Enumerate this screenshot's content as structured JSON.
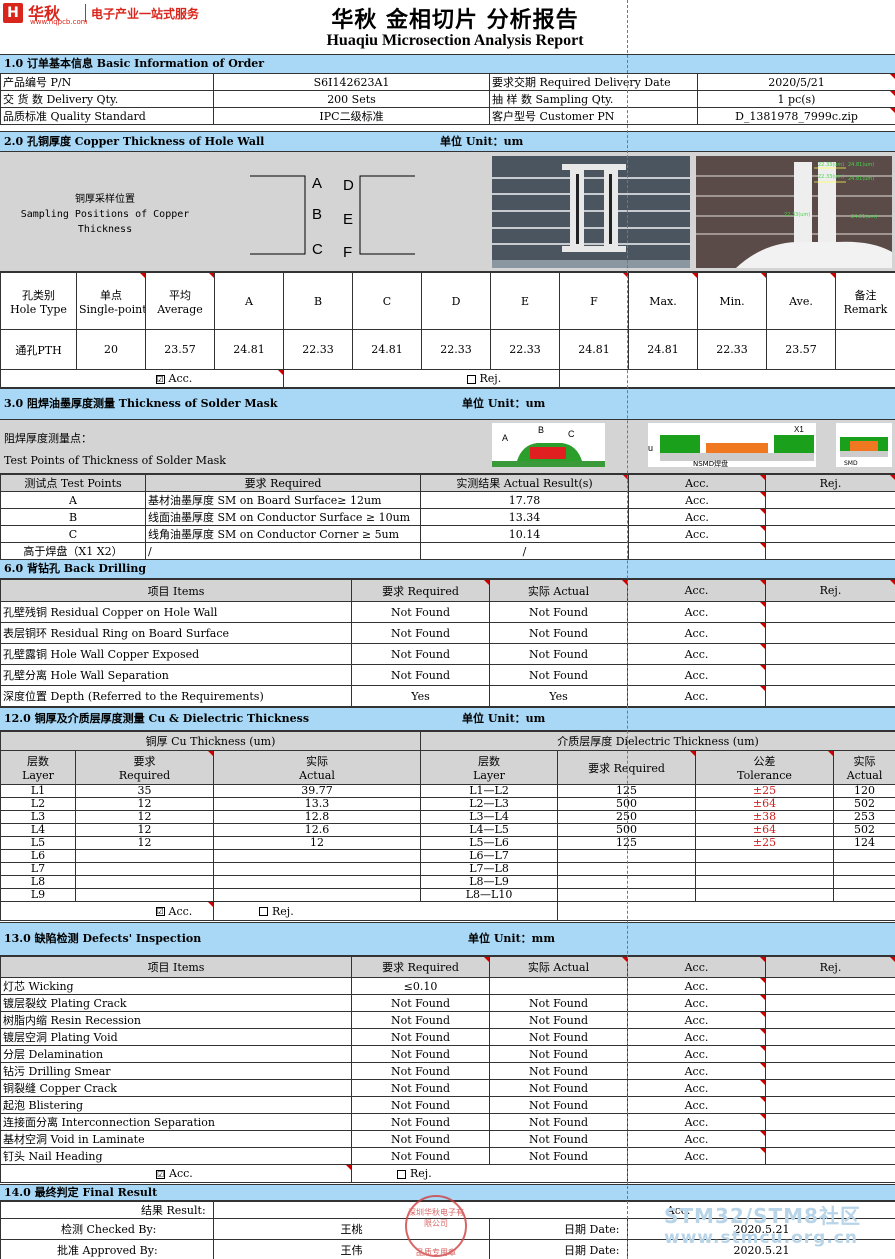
{
  "header": {
    "logo_glyph": "H",
    "logo_cn": "华秋",
    "logo_url": "www.hqpcb.com",
    "slogan": "电子产业一站式服务",
    "title_cn": "华秋 金相切片 分析报告",
    "title_en": "Huaqiu Microsection Analysis Report"
  },
  "s1": {
    "title": "1.0 订单基本信息 Basic Information of Order",
    "rows": [
      [
        "产品编号 P/N",
        "S6I142623A1",
        "要求交期 Required Delivery Date",
        "2020/5/21"
      ],
      [
        "交 货 数 Delivery Qty.",
        "200 Sets",
        "抽 样 数 Sampling Qty.",
        "1 pc(s)"
      ],
      [
        "品质标准 Quality Standard",
        "IPC二级标准",
        "客户型号 Customer PN",
        "D_1381978_7999c.zip"
      ]
    ]
  },
  "s2": {
    "title": "2.0 孔铜厚度 Copper Thickness of Hole Wall",
    "unit": "单位 Unit：um",
    "pos_cn": "铜厚采样位置",
    "pos_en1": "Sampling Positions of Copper",
    "pos_en2": "Thickness",
    "letters": [
      "A",
      "B",
      "C",
      "D",
      "E",
      "F"
    ],
    "img1_labels": [
      "22.33",
      "24.81",
      "23.57"
    ],
    "img2_labels": [
      "22.33(um)",
      "24.81(um)",
      "22.33(um)",
      "24.81(um)",
      "22.33(um)",
      "24.81(um)"
    ],
    "headers": [
      [
        "孔类别",
        "Hole Type"
      ],
      [
        "单点",
        "Single-point"
      ],
      [
        "平均",
        "Average"
      ],
      [
        "A"
      ],
      [
        "B"
      ],
      [
        "C"
      ],
      [
        "D"
      ],
      [
        "E"
      ],
      [
        "F"
      ],
      [
        "Max."
      ],
      [
        "Min."
      ],
      [
        "Ave."
      ],
      [
        "备注",
        "Remark"
      ]
    ],
    "values": [
      "通孔PTH",
      "20",
      "23.57",
      "24.81",
      "22.33",
      "24.81",
      "22.33",
      "22.33",
      "24.81",
      "24.81",
      "22.33",
      "23.57",
      ""
    ],
    "acc": "Acc.",
    "rej": "Rej.",
    "acc_mark": "☑"
  },
  "s3": {
    "title": "3.0 阻焊油墨厚度测量 Thickness of Solder Mask",
    "unit": "单位 Unit：um",
    "tp_cn": "阻焊厚度测量点：",
    "tp_en": "Test Points of Thickness of Solder Mask",
    "diag_labels": [
      "A",
      "B",
      "C"
    ],
    "diag2_labels": [
      "X1",
      "u",
      "NSMD焊盘"
    ],
    "diag3_label": "SMD",
    "headers": [
      "测试点 Test Points",
      "要求 Required",
      "实测结果 Actual Result(s)",
      "Acc.",
      "Rej."
    ],
    "rows": [
      [
        "A",
        "基材油墨厚度 SM on Board Surface≥ 12um",
        "17.78",
        "Acc.",
        ""
      ],
      [
        "B",
        "线面油墨厚度 SM on Conductor Surface ≥ 10um",
        "13.34",
        "Acc.",
        ""
      ],
      [
        "C",
        "线角油墨厚度 SM on Conductor Corner ≥ 5um",
        "10.14",
        "Acc.",
        ""
      ],
      [
        "高于焊盘（X1 X2）",
        "/",
        "/",
        "",
        ""
      ]
    ]
  },
  "s6": {
    "title": "6.0 背钻孔 Back Drilling",
    "headers": [
      "项目 Items",
      "要求 Required",
      "实际 Actual",
      "Acc.",
      "Rej."
    ],
    "rows": [
      [
        "孔壁残铜 Residual Copper on Hole Wall",
        "Not Found",
        "Not Found",
        "Acc.",
        ""
      ],
      [
        "表层铜环 Residual Ring on Board Surface",
        "Not Found",
        "Not Found",
        "Acc.",
        ""
      ],
      [
        "孔壁露铜 Hole Wall Copper Exposed",
        "Not Found",
        "Not Found",
        "Acc.",
        ""
      ],
      [
        "孔壁分离 Hole Wall Separation",
        "Not Found",
        "Not Found",
        "Acc.",
        ""
      ],
      [
        "深度位置 Depth (Referred to the Requirements)",
        "Yes",
        "Yes",
        "Acc.",
        ""
      ]
    ]
  },
  "s12": {
    "title": "12.0 铜厚及介质层厚度测量 Cu & Dielectric Thickness",
    "unit": "单位 Unit：um",
    "cu_title": "铜厚 Cu Thickness (um)",
    "di_title": "介质层厚度 Dielectric Thickness (um)",
    "h": [
      "层数",
      "Layer",
      "要求",
      "Required",
      "实际",
      "Actual",
      "层数",
      "Layer",
      "要求 Required",
      "公差",
      "Tolerance",
      "实际",
      "Actual"
    ],
    "rows": [
      [
        "L1",
        "35",
        "39.77",
        "L1—L2",
        "125",
        "±25",
        "120"
      ],
      [
        "L2",
        "12",
        "13.3",
        "L2—L3",
        "500",
        "±64",
        "502"
      ],
      [
        "L3",
        "12",
        "12.8",
        "L3—L4",
        "250",
        "±38",
        "253"
      ],
      [
        "L4",
        "12",
        "12.6",
        "L4—L5",
        "500",
        "±64",
        "502"
      ],
      [
        "L5",
        "12",
        "12",
        "L5—L6",
        "125",
        "±25",
        "124"
      ],
      [
        "L6",
        "",
        "",
        "L6—L7",
        "",
        "",
        ""
      ],
      [
        "L7",
        "",
        "",
        "L7—L8",
        "",
        "",
        ""
      ],
      [
        "L8",
        "",
        "",
        "L8—L9",
        "",
        "",
        ""
      ],
      [
        "L9",
        "",
        "",
        "L8—L10",
        "",
        "",
        ""
      ]
    ],
    "acc": "Acc.",
    "rej": "Rej.",
    "acc_mark": "☑"
  },
  "s13": {
    "title": "13.0 缺陷检测 Defects' Inspection",
    "unit": "单位 Unit：mm",
    "headers": [
      "项目 Items",
      "要求 Required",
      "实际 Actual",
      "Acc.",
      "Rej."
    ],
    "rows": [
      [
        "灯芯 Wicking",
        "≤0.10",
        "",
        "Acc.",
        ""
      ],
      [
        "镀层裂纹 Plating Crack",
        "Not Found",
        "Not Found",
        "Acc.",
        ""
      ],
      [
        "树脂内缩 Resin Recession",
        "Not Found",
        "Not Found",
        "Acc.",
        ""
      ],
      [
        "镀层空洞 Plating Void",
        "Not Found",
        "Not Found",
        "Acc.",
        ""
      ],
      [
        "分层 Delamination",
        "Not Found",
        "Not Found",
        "Acc.",
        ""
      ],
      [
        "钻污 Drilling Smear",
        "Not Found",
        "Not Found",
        "Acc.",
        ""
      ],
      [
        "铜裂缝 Copper Crack",
        "Not Found",
        "Not Found",
        "Acc.",
        ""
      ],
      [
        "起泡 Blistering",
        "Not Found",
        "Not Found",
        "Acc.",
        ""
      ],
      [
        "连接面分离 Interconnection Separation",
        "Not Found",
        "Not Found",
        "Acc.",
        ""
      ],
      [
        "基材空洞 Void in Laminate",
        "Not Found",
        "Not Found",
        "Acc.",
        ""
      ],
      [
        "钉头 Nail Heading",
        "Not Found",
        "Not Found",
        "Acc.",
        ""
      ]
    ],
    "acc": "Acc.",
    "rej": "Rej.",
    "acc_mark": "☑"
  },
  "s14": {
    "title": "14.0 最终判定 Final Result",
    "result_label": "结果 Result:",
    "result_value": "Acc.",
    "checked_label": "检测 Checked By:",
    "checked_name": "王桃",
    "approved_label": "批准 Approved By:",
    "approved_name": "王伟",
    "date_label": "日期 Date:",
    "date1": "2020.5.21",
    "date2": "2020.5.21",
    "stamp_text": "深圳华秋电子有限公司",
    "stamp_sub": "品质专用章"
  },
  "watermark": {
    "line1": "STM32/STM8社区",
    "line2": "www.stmcu.org.cn"
  },
  "colors": {
    "section_bg": "#a8d8f5",
    "header_gray": "#d4d4d4",
    "brand_red": "#d9261c",
    "tolerance_red": "#d02020"
  }
}
